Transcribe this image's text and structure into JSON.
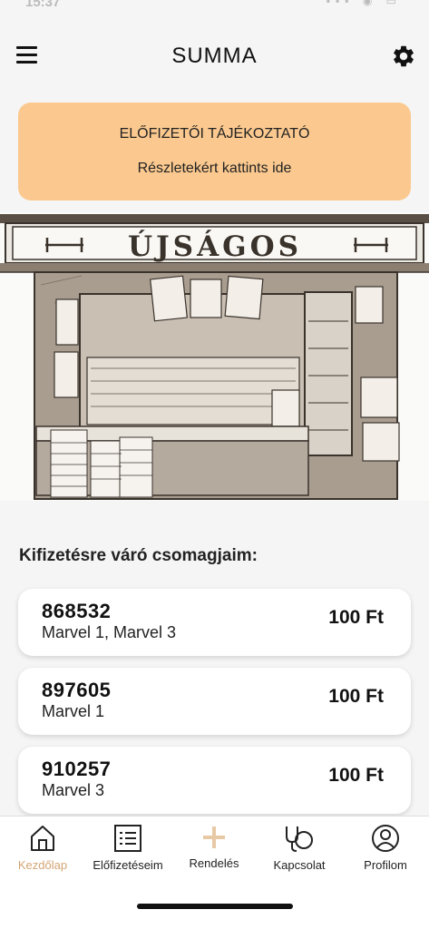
{
  "status": {
    "time": "15:37",
    "icons": "▪▪▪ ◉ ▭"
  },
  "header": {
    "title": "SUMMA"
  },
  "info_banner": {
    "title": "ELŐFIZETŐI TÁJÉKOZTATÓ",
    "link": "Részletekért kattints ide"
  },
  "kiosk": {
    "sign": "ÚJSÁGOS"
  },
  "section": {
    "title": "Kifizetésre váró csomagjaim:"
  },
  "packages": [
    {
      "id": "868532",
      "items": "Marvel 1, Marvel 3",
      "price": "100 Ft"
    },
    {
      "id": "897605",
      "items": "Marvel 1",
      "price": "100 Ft"
    },
    {
      "id": "910257",
      "items": "Marvel 3",
      "price": "100 Ft"
    }
  ],
  "tabs": [
    {
      "label": "Kezdőlap",
      "icon": "home-icon"
    },
    {
      "label": "Előfizetéseim",
      "icon": "list-icon"
    },
    {
      "label": "Rendelés",
      "icon": "plus-icon"
    },
    {
      "label": "Kapcsolat",
      "icon": "contact-icon"
    },
    {
      "label": "Profilom",
      "icon": "profile-icon"
    }
  ],
  "colors": {
    "accent": "#d4a574",
    "banner": "#fbc98f",
    "background": "#f5f5f5"
  }
}
